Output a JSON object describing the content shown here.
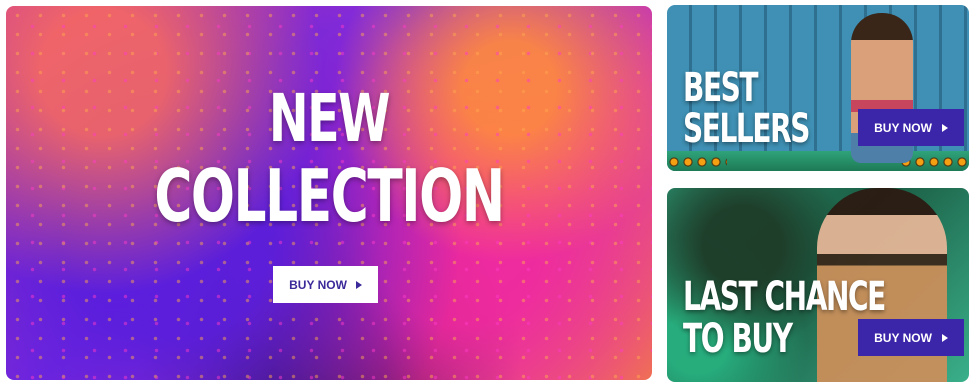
{
  "hero": {
    "title_line1": "NEW",
    "title_line2": "COLLECTION",
    "button_label": "BUY NOW",
    "button_color": "#ffffff",
    "button_text_color": "#3b2a99"
  },
  "best_sellers": {
    "title_line1": "BEST",
    "title_line2": "SELLERS",
    "button_label": "BUY NOW",
    "button_color": "#3b25a8"
  },
  "last_chance": {
    "title_line1": "LAST CHANCE",
    "title_line2": "TO BUY",
    "button_label": "BUY NOW",
    "button_color": "#3b25a8"
  },
  "icons": {
    "button_arrow": "play-triangle-icon"
  }
}
